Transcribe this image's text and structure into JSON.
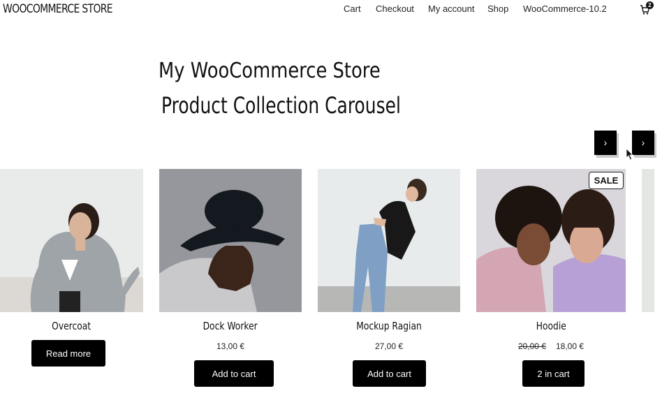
{
  "header": {
    "site_title": "WOOCOMMERCE STORE",
    "nav": [
      "Cart",
      "Checkout",
      "My account",
      "Shop",
      "WooCommerce-10.2"
    ],
    "cart_count": "2"
  },
  "main": {
    "store_heading": "My WooCommerce Store",
    "section_heading": "Product Collection Carousel",
    "prev_label": "›",
    "next_label": "›"
  },
  "products": [
    {
      "name": "Overcoat",
      "price": "",
      "button": "Read more"
    },
    {
      "name": "Dock Worker",
      "price": "13,00 €",
      "button": "Add to cart"
    },
    {
      "name": "Mockup Ragian",
      "price": "27,00 €",
      "button": "Add to cart"
    },
    {
      "name": "Hoodie",
      "old_price": "20,00 €",
      "price": "18,00 €",
      "button": "2 in cart",
      "badge": "SALE"
    }
  ],
  "colors": {
    "button_bg": "#000000",
    "text": "#111111"
  }
}
